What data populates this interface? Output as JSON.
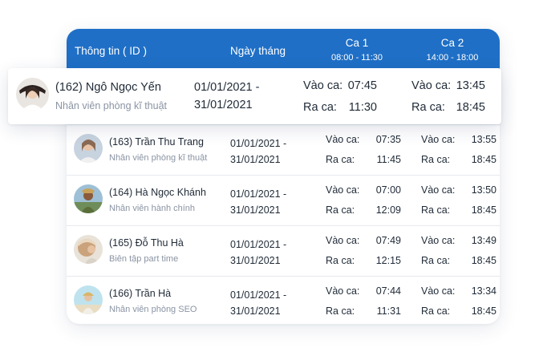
{
  "header": {
    "info": "Thông tin ( ID )",
    "date": "Ngày tháng",
    "shift1": {
      "title": "Ca 1",
      "time": "08:00 - 11:30"
    },
    "shift2": {
      "title": "Ca 2",
      "time": "14:00 - 18:00"
    }
  },
  "labels": {
    "in": "Vào ca:",
    "out": "Ra ca:"
  },
  "highlight": {
    "name": "(162) Ngô Ngọc Yến",
    "role": "Nhân viên phòng kĩ thuật",
    "date_from": "01/01/2021 -",
    "date_to": "31/01/2021",
    "s1_in": "07:45",
    "s1_out": "11:30",
    "s2_in": "13:45",
    "s2_out": "18:45"
  },
  "rows": [
    {
      "name": "(163) Trần Thu Trang",
      "role": "Nhân viên phòng kĩ thuật",
      "date_from": "01/01/2021 -",
      "date_to": "31/01/2021",
      "s1_in": "07:35",
      "s1_out": "11:45",
      "s2_in": "13:55",
      "s2_out": "18:45"
    },
    {
      "name": "(164) Hà Ngọc Khánh",
      "role": "Nhân viên hành chính",
      "date_from": "01/01/2021 -",
      "date_to": "31/01/2021",
      "s1_in": "07:00",
      "s1_out": "12:09",
      "s2_in": "13:50",
      "s2_out": "18:45"
    },
    {
      "name": "(165) Đỗ Thu Hà",
      "role": "Biên tập part time",
      "date_from": "01/01/2021 -",
      "date_to": "31/01/2021",
      "s1_in": "07:49",
      "s1_out": "12:15",
      "s2_in": "13:49",
      "s2_out": "18:45"
    },
    {
      "name": "(166) Trần Hà",
      "role": "Nhân viên phòng SEO",
      "date_from": "01/01/2021 -",
      "date_to": "31/01/2021",
      "s1_in": "07:44",
      "s1_out": "11:31",
      "s2_in": "13:34",
      "s2_out": "18:45"
    }
  ],
  "colors": {
    "header_bg": "#1f6fc6",
    "text": "#1f2a37",
    "muted": "#8a94a3"
  }
}
